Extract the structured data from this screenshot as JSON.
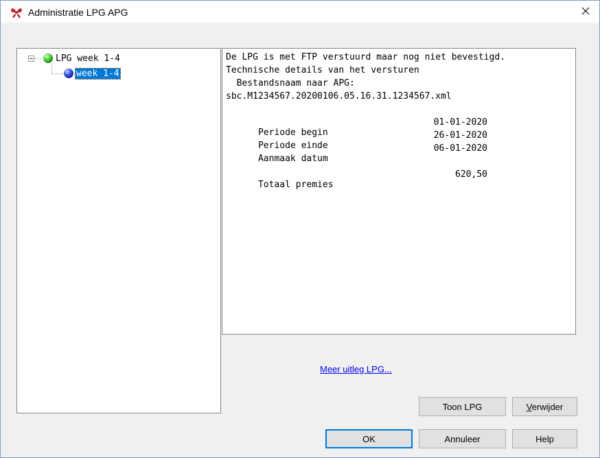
{
  "window": {
    "title": "Administratie LPG APG"
  },
  "tree": {
    "root": {
      "label": "LPG week 1-4",
      "expanded": true
    },
    "child": {
      "label": "week 1-4",
      "selected": true
    }
  },
  "details": {
    "status": "De LPG is met FTP verstuurd maar nog niet bevestigd.",
    "tech_header": "Technische details van het versturen",
    "filename_label": "  Bestandsnaam naar APG:",
    "filename": "sbc.M1234567.20200106.05.16.31.1234567.xml",
    "rows": [
      {
        "label": "Periode begin",
        "value": "01-01-2020"
      },
      {
        "label": "Periode einde",
        "value": "26-01-2020"
      },
      {
        "label": "Aanmaak datum",
        "value": "06-01-2020"
      }
    ],
    "total": {
      "label": "Totaal premies",
      "value": "620,50"
    }
  },
  "link": {
    "label": "Meer uitleg LPG..."
  },
  "buttons": {
    "toon": "Toon LPG",
    "verwijder_first": "V",
    "verwijder_rest": "erwijder",
    "ok": "OK",
    "annuleer": "Annuleer",
    "help": "Help"
  },
  "colors": {
    "selection": "#0078d7",
    "link": "#0000ee",
    "default_button_border": "#0078d7"
  },
  "icons": {
    "app": "butterfly-icon",
    "close": "close-icon",
    "root_node": "green-ball-icon",
    "child_node": "blue-ball-icon"
  }
}
